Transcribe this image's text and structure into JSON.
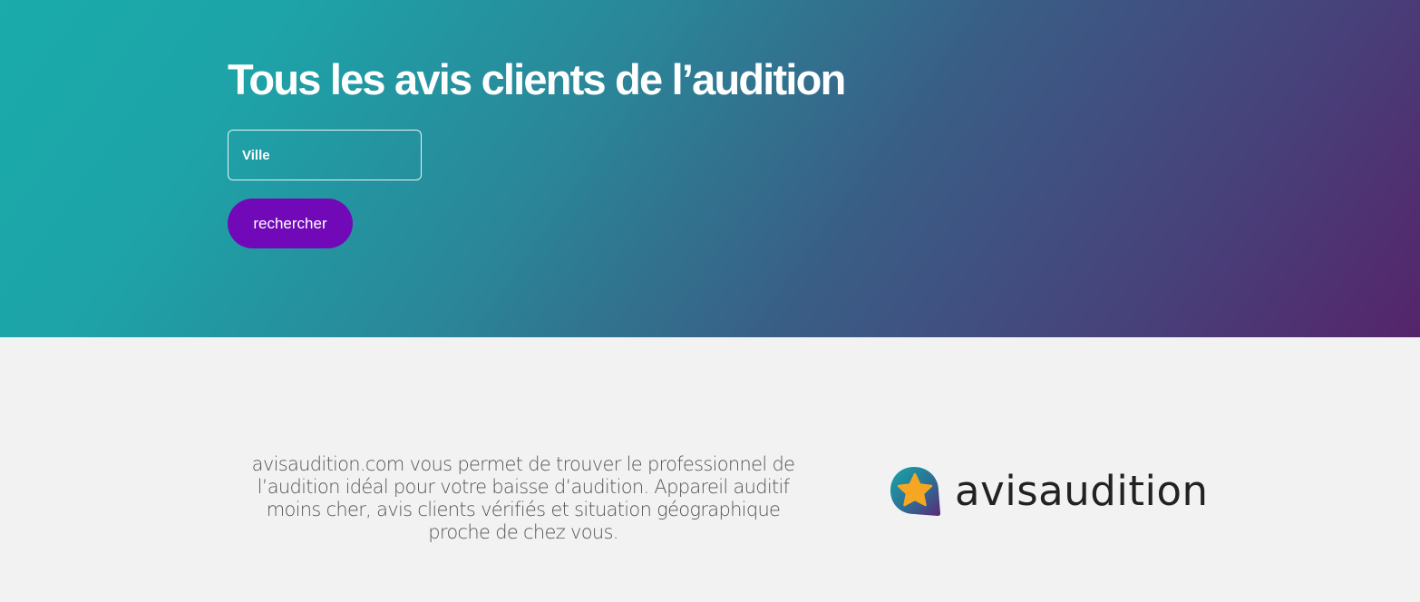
{
  "hero": {
    "title": "Tous les avis clients de l’audition",
    "city_placeholder": "Ville",
    "search_button_label": "rechercher"
  },
  "about": {
    "tagline": "avisaudition.com vous permet de trouver le professionnel de l’audition idéal pour votre baisse d’audition. Appareil auditif moins cher, avis clients vérifiés et situation géographique proche de chez vous."
  },
  "brand": {
    "logo_text": "avisaudition",
    "logo_icon": "star-bubble-icon"
  },
  "colors": {
    "hero_gradient_start": "#1aabaa",
    "hero_gradient_end": "#55246b",
    "button": "#7109b8",
    "star": "#f5a623",
    "lower_background": "#f2f2f3"
  }
}
